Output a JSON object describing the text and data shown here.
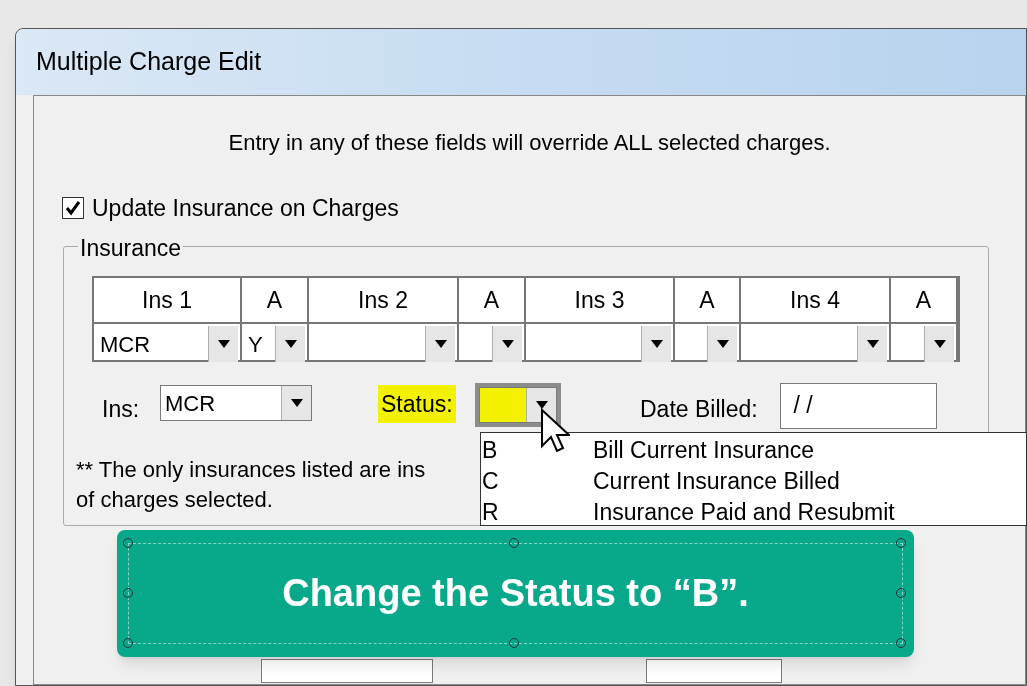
{
  "window": {
    "title": "Multiple Charge Edit"
  },
  "notice": "Entry in any of these fields will override ALL selected charges.",
  "update_insurance": {
    "label": "Update Insurance on Charges",
    "checked": true
  },
  "insurance_group": {
    "title": "Insurance",
    "columns": [
      {
        "header": "Ins 1",
        "value": "MCR"
      },
      {
        "header": "A",
        "value": "Y"
      },
      {
        "header": "Ins 2"
      },
      {
        "header": "A"
      },
      {
        "header": "Ins 3"
      },
      {
        "header": "A"
      },
      {
        "header": "Ins 4"
      },
      {
        "header": "A"
      }
    ],
    "ins": {
      "label": "Ins:",
      "value": "MCR"
    },
    "status": {
      "label": "Status:",
      "highlighted": true,
      "expanded": true,
      "options": [
        {
          "code": "B",
          "description": "Bill Current Insurance"
        },
        {
          "code": "C",
          "description": "Current Insurance Billed"
        },
        {
          "code": "R",
          "description": "Insurance Paid and Resubmit"
        }
      ]
    },
    "date_billed": {
      "label": "Date Billed:",
      "value": " / /"
    },
    "note": [
      "** The only insurances listed are ins",
      "of charges selected."
    ]
  },
  "callout": {
    "text": "Change the Status to “B”."
  }
}
